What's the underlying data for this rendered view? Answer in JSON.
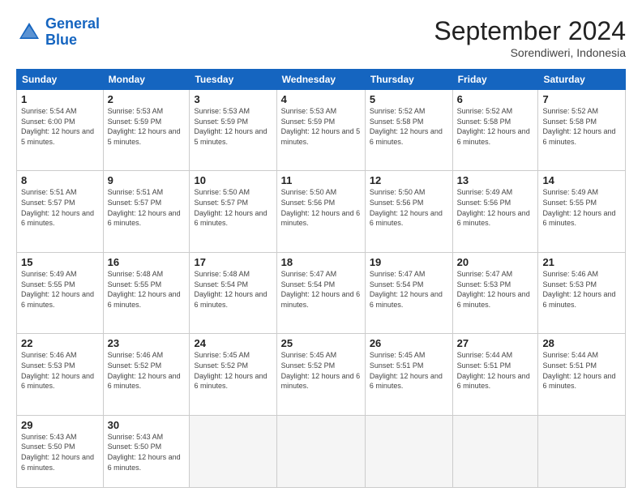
{
  "logo": {
    "line1": "General",
    "line2": "Blue"
  },
  "title": "September 2024",
  "location": "Sorendiweri, Indonesia",
  "days_header": [
    "Sunday",
    "Monday",
    "Tuesday",
    "Wednesday",
    "Thursday",
    "Friday",
    "Saturday"
  ],
  "weeks": [
    [
      {
        "day": "1",
        "sunrise": "5:54 AM",
        "sunset": "6:00 PM",
        "daylight": "12 hours and 5 minutes."
      },
      {
        "day": "2",
        "sunrise": "5:53 AM",
        "sunset": "5:59 PM",
        "daylight": "12 hours and 5 minutes."
      },
      {
        "day": "3",
        "sunrise": "5:53 AM",
        "sunset": "5:59 PM",
        "daylight": "12 hours and 5 minutes."
      },
      {
        "day": "4",
        "sunrise": "5:53 AM",
        "sunset": "5:59 PM",
        "daylight": "12 hours and 5 minutes."
      },
      {
        "day": "5",
        "sunrise": "5:52 AM",
        "sunset": "5:58 PM",
        "daylight": "12 hours and 6 minutes."
      },
      {
        "day": "6",
        "sunrise": "5:52 AM",
        "sunset": "5:58 PM",
        "daylight": "12 hours and 6 minutes."
      },
      {
        "day": "7",
        "sunrise": "5:52 AM",
        "sunset": "5:58 PM",
        "daylight": "12 hours and 6 minutes."
      }
    ],
    [
      {
        "day": "8",
        "sunrise": "5:51 AM",
        "sunset": "5:57 PM",
        "daylight": "12 hours and 6 minutes."
      },
      {
        "day": "9",
        "sunrise": "5:51 AM",
        "sunset": "5:57 PM",
        "daylight": "12 hours and 6 minutes."
      },
      {
        "day": "10",
        "sunrise": "5:50 AM",
        "sunset": "5:57 PM",
        "daylight": "12 hours and 6 minutes."
      },
      {
        "day": "11",
        "sunrise": "5:50 AM",
        "sunset": "5:56 PM",
        "daylight": "12 hours and 6 minutes."
      },
      {
        "day": "12",
        "sunrise": "5:50 AM",
        "sunset": "5:56 PM",
        "daylight": "12 hours and 6 minutes."
      },
      {
        "day": "13",
        "sunrise": "5:49 AM",
        "sunset": "5:56 PM",
        "daylight": "12 hours and 6 minutes."
      },
      {
        "day": "14",
        "sunrise": "5:49 AM",
        "sunset": "5:55 PM",
        "daylight": "12 hours and 6 minutes."
      }
    ],
    [
      {
        "day": "15",
        "sunrise": "5:49 AM",
        "sunset": "5:55 PM",
        "daylight": "12 hours and 6 minutes."
      },
      {
        "day": "16",
        "sunrise": "5:48 AM",
        "sunset": "5:55 PM",
        "daylight": "12 hours and 6 minutes."
      },
      {
        "day": "17",
        "sunrise": "5:48 AM",
        "sunset": "5:54 PM",
        "daylight": "12 hours and 6 minutes."
      },
      {
        "day": "18",
        "sunrise": "5:47 AM",
        "sunset": "5:54 PM",
        "daylight": "12 hours and 6 minutes."
      },
      {
        "day": "19",
        "sunrise": "5:47 AM",
        "sunset": "5:54 PM",
        "daylight": "12 hours and 6 minutes."
      },
      {
        "day": "20",
        "sunrise": "5:47 AM",
        "sunset": "5:53 PM",
        "daylight": "12 hours and 6 minutes."
      },
      {
        "day": "21",
        "sunrise": "5:46 AM",
        "sunset": "5:53 PM",
        "daylight": "12 hours and 6 minutes."
      }
    ],
    [
      {
        "day": "22",
        "sunrise": "5:46 AM",
        "sunset": "5:53 PM",
        "daylight": "12 hours and 6 minutes."
      },
      {
        "day": "23",
        "sunrise": "5:46 AM",
        "sunset": "5:52 PM",
        "daylight": "12 hours and 6 minutes."
      },
      {
        "day": "24",
        "sunrise": "5:45 AM",
        "sunset": "5:52 PM",
        "daylight": "12 hours and 6 minutes."
      },
      {
        "day": "25",
        "sunrise": "5:45 AM",
        "sunset": "5:52 PM",
        "daylight": "12 hours and 6 minutes."
      },
      {
        "day": "26",
        "sunrise": "5:45 AM",
        "sunset": "5:51 PM",
        "daylight": "12 hours and 6 minutes."
      },
      {
        "day": "27",
        "sunrise": "5:44 AM",
        "sunset": "5:51 PM",
        "daylight": "12 hours and 6 minutes."
      },
      {
        "day": "28",
        "sunrise": "5:44 AM",
        "sunset": "5:51 PM",
        "daylight": "12 hours and 6 minutes."
      }
    ],
    [
      {
        "day": "29",
        "sunrise": "5:43 AM",
        "sunset": "5:50 PM",
        "daylight": "12 hours and 6 minutes."
      },
      {
        "day": "30",
        "sunrise": "5:43 AM",
        "sunset": "5:50 PM",
        "daylight": "12 hours and 6 minutes."
      },
      null,
      null,
      null,
      null,
      null
    ]
  ]
}
